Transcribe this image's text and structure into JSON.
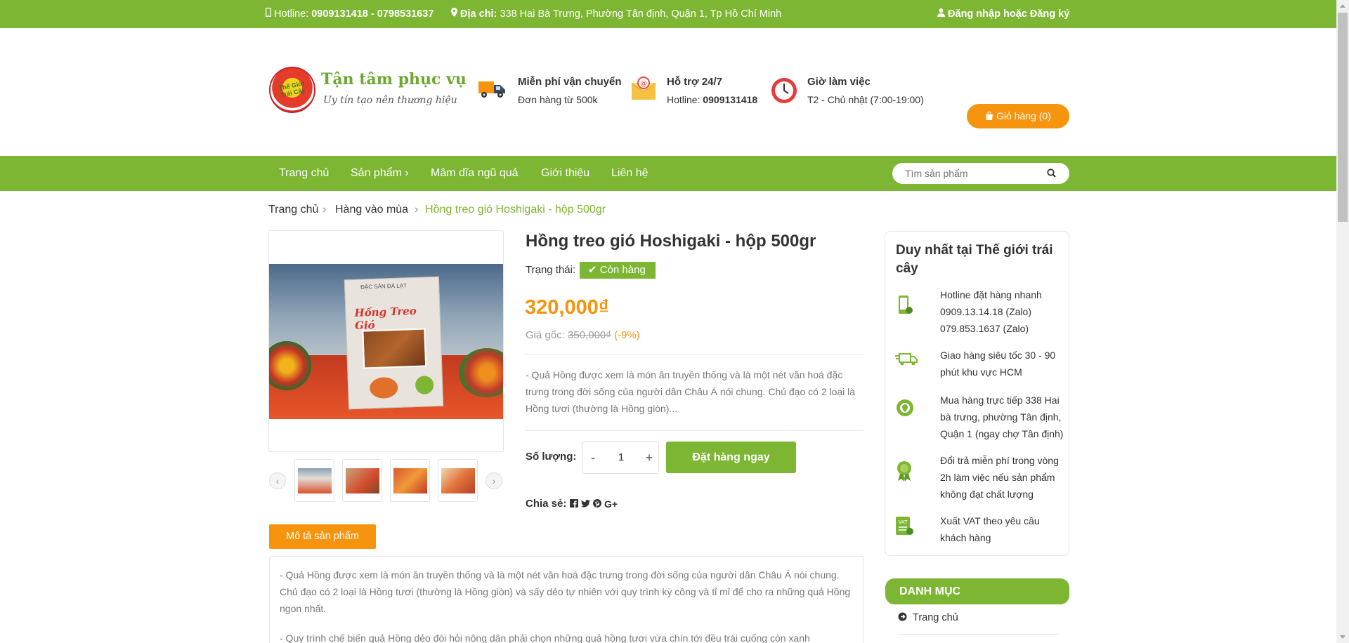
{
  "topbar": {
    "hotline_label": "Hotline:",
    "hotline_value": "0909131418 - 0798531637",
    "address_label": "Địa chỉ:",
    "address_value": "338 Hai Bà Trưng, Phường Tân định, Quận 1, Tp Hồ Chí Minh",
    "login": "Đăng nhập",
    "or": "hoặc",
    "register": "Đăng ký"
  },
  "header": {
    "logo_text": "Thế Giới Trái Cây",
    "brand_title": "Tận tâm phục vụ",
    "brand_sub": "Uy tín tạo nên thương hiệu",
    "features": [
      {
        "title": "Miễn phí vận chuyển",
        "sub": "Đơn hàng từ 500k",
        "icon": "truck-icon"
      },
      {
        "title": "Hỗ trợ 24/7",
        "sub_label": "Hotline:",
        "sub_value": "0909131418",
        "icon": "mail-icon"
      },
      {
        "title": "Giờ làm việc",
        "sub": "T2 - Chủ nhật (7:00-19:00)",
        "icon": "clock-icon"
      }
    ],
    "cart_label": "Giỏ hàng (0)"
  },
  "nav": {
    "items": [
      "Trang chủ",
      "Sản phẩm",
      "Mâm dĩa ngũ quả",
      "Giới thiệu",
      "Liên hệ"
    ],
    "search_placeholder": "Tìm sản phẩm"
  },
  "breadcrumb": [
    "Trang chủ",
    "Hàng vào mùa",
    "Hồng treo gió Hoshigaki - hộp 500gr"
  ],
  "product": {
    "title": "Hồng treo gió Hoshigaki - hộp 500gr",
    "status_label": "Trạng thái:",
    "status_value": "Còn hàng",
    "price": "320,000₫",
    "old_price_label": "Giá gốc:",
    "old_price": "350,000₫",
    "discount": "(-9%)",
    "short_desc": "- Quả Hồng được xem là món ăn truyền thống và là một nét văn hoá đặc trưng trong đời sống của người dân Châu Á nói chung. Chủ đạo có 2 loại là Hồng tươi (thường là Hồng giòn)...",
    "qty_label": "Số lượng:",
    "qty_value": "1",
    "qty_minus": "-",
    "qty_plus": "+",
    "order_button": "Đặt hàng ngay",
    "share_label": "Chia sẻ:",
    "photo_box_label": "Hồng Treo Gió",
    "photo_box_top": "ĐẶC SẢN ĐÀ LẠT"
  },
  "tab": {
    "label": "Mô tả sản phẩm",
    "p1": "- Quả Hồng được xem là món ăn truyền thống và là một nét văn hoá đặc trưng trong đời sống của người dân Châu Á nói chung. Chủ đạo có 2 loại là Hồng tươi (thường là Hồng giòn) và sấy dẻo tự nhiên với quy trình kỳ công và tỉ mỉ để cho ra những quả Hồng ngon nhất.",
    "p2": "- Quy trình chế biến quả Hồng dẻo đòi hỏi nông dân phải chọn những quả hồng tươi vừa chín tới đều trái cuống còn xanh"
  },
  "sidebar": {
    "title": "Duy nhất tại Thế giới trái cây",
    "rows": [
      {
        "text": "Hotline đặt hàng nhanh 0909.13.14.18 (Zalo) 079.853.1637 (Zalo)",
        "icon": "phone-icon"
      },
      {
        "text": "Giao hàng siêu tốc 30 - 90 phút khu vực HCM",
        "icon": "fast-delivery-icon"
      },
      {
        "text": "Mua hàng trực tiếp 338 Hai bà trưng, phường Tân định, Quận 1 (ngay chợ Tân định)",
        "icon": "location-icon"
      },
      {
        "text": "Đổi trả miễn phí trong vòng 2h làm việc nếu sản phẩm không đạt chất lượng",
        "icon": "medal-icon"
      },
      {
        "text": "Xuất VAT theo yêu cầu khách hàng",
        "icon": "vat-icon"
      }
    ],
    "category_title": "DANH MỤC",
    "category_first": "Trang chủ"
  },
  "colors": {
    "green": "#7cb632",
    "orange": "#f7940d"
  }
}
